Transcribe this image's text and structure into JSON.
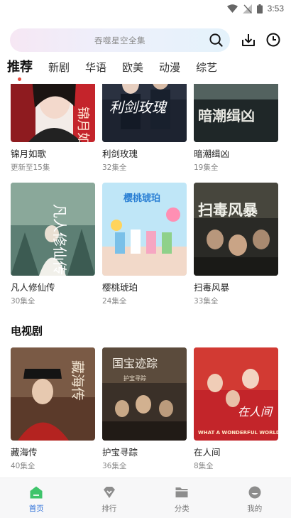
{
  "status": {
    "time": "3:53"
  },
  "search": {
    "placeholder": "吞噬星空全集"
  },
  "tabs": [
    "推荐",
    "新剧",
    "华语",
    "欧美",
    "动漫",
    "综艺"
  ],
  "rows": [
    [
      {
        "title": "锦月如歌",
        "sub": "更新至15集"
      },
      {
        "title": "利剑玫瑰",
        "sub": "32集全"
      },
      {
        "title": "暗潮缉凶",
        "sub": "19集全"
      }
    ],
    [
      {
        "title": "凡人修仙传",
        "sub": "30集全"
      },
      {
        "title": "樱桃琥珀",
        "sub": "24集全"
      },
      {
        "title": "扫毒风暴",
        "sub": "33集全"
      }
    ]
  ],
  "section_tv": {
    "title": "电视剧",
    "items": [
      {
        "title": "藏海传",
        "sub": "40集全"
      },
      {
        "title": "护宝寻踪",
        "sub": "36集全"
      },
      {
        "title": "在人间",
        "sub": "8集全"
      }
    ]
  },
  "posters": {
    "p1": "锦月如歌",
    "p2": "利剑玫瑰",
    "p3": "暗潮缉凶",
    "p4": "凡人修仙传",
    "p5": "樱桃琥珀",
    "p6": "扫毒风暴",
    "p7": "藏海传",
    "p8": "国宝迹踪",
    "p8b": "护宝寻踪",
    "p9": "在人间",
    "p9b": "WHAT A WONDERFUL WORLD"
  },
  "bottom_nav": [
    {
      "label": "首页",
      "icon": "home-icon",
      "active": true
    },
    {
      "label": "排行",
      "icon": "rank-icon",
      "active": false
    },
    {
      "label": "分类",
      "icon": "folder-icon",
      "active": false
    },
    {
      "label": "我的",
      "icon": "profile-icon",
      "active": false
    }
  ],
  "colors": {
    "accent": "#2b6fd9",
    "home_icon": "#3fc46b",
    "tab_dot": "#e84a3b"
  }
}
